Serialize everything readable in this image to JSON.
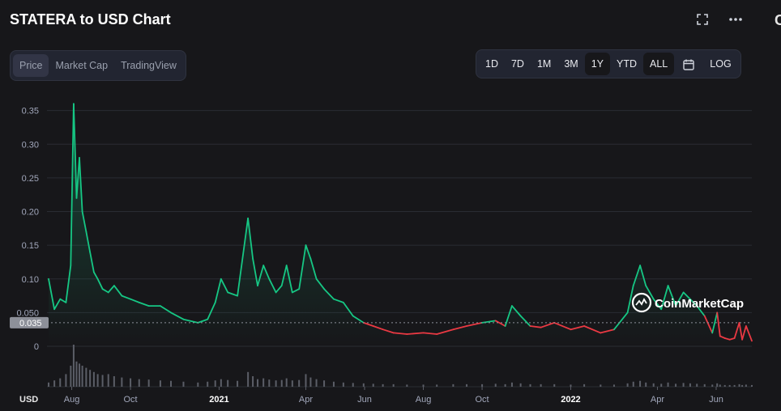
{
  "header": {
    "title": "STATERA to USD Chart",
    "edge_char": "C"
  },
  "view_tabs": [
    "Price",
    "Market Cap",
    "TradingView"
  ],
  "active_view": "Price",
  "range_buttons": [
    "1D",
    "7D",
    "1M",
    "3M",
    "1Y",
    "YTD",
    "ALL"
  ],
  "active_range": "ALL",
  "log_label": "LOG",
  "icons": {
    "fullscreen": "fullscreen-icon",
    "more": "more-icon",
    "calendar": "calendar-icon"
  },
  "colors": {
    "up": "#16c784",
    "down": "#ea3943",
    "background": "#17171a",
    "grid": "#2a2c33",
    "volume": "#5b5e67",
    "price_label_bg": "#8d9099"
  },
  "watermark": "CoinMarketCap",
  "chart_data": {
    "type": "line",
    "currency_label": "USD",
    "current_price_label": "0.035",
    "y_ticks": [
      0,
      0.05,
      0.1,
      0.15,
      0.2,
      0.25,
      0.3,
      0.35
    ],
    "y_tick_labels": [
      "0",
      "0.050",
      "0.10",
      "0.15",
      "0.20",
      "0.25",
      "0.30",
      "0.35"
    ],
    "ylim": [
      0,
      0.37
    ],
    "x_tick_labels": [
      "Aug",
      "Oct",
      "2021",
      "Apr",
      "Jun",
      "Aug",
      "Oct",
      "2022",
      "Apr",
      "Jun"
    ],
    "x_ticks": [
      "2020-08-01",
      "2020-10-01",
      "2021-01-01",
      "2021-04-01",
      "2021-06-01",
      "2021-08-01",
      "2021-10-01",
      "2022-01-01",
      "2022-04-01",
      "2022-06-01"
    ],
    "x_range": [
      "2020-07-08",
      "2022-07-08"
    ],
    "reference_price": 0.035,
    "series": [
      {
        "x": [
          "2020-07-08",
          "2020-07-14",
          "2020-07-20",
          "2020-07-26",
          "2020-07-31",
          "2020-08-03",
          "2020-08-06",
          "2020-08-09",
          "2020-08-12",
          "2020-08-16",
          "2020-08-20",
          "2020-08-24",
          "2020-08-28",
          "2020-09-02",
          "2020-09-08",
          "2020-09-14",
          "2020-09-22",
          "2020-10-01",
          "2020-10-10",
          "2020-10-20",
          "2020-11-01",
          "2020-11-12",
          "2020-11-25",
          "2020-12-10",
          "2020-12-20",
          "2020-12-28",
          "2021-01-03",
          "2021-01-10",
          "2021-01-20",
          "2021-01-31",
          "2021-02-05",
          "2021-02-10",
          "2021-02-16",
          "2021-02-22",
          "2021-03-01",
          "2021-03-07",
          "2021-03-12",
          "2021-03-18",
          "2021-03-25",
          "2021-04-01",
          "2021-04-06",
          "2021-04-12",
          "2021-04-20",
          "2021-04-30",
          "2021-05-10",
          "2021-05-20",
          "2021-05-31",
          "2021-06-10",
          "2021-06-20",
          "2021-07-01",
          "2021-07-15",
          "2021-08-01",
          "2021-08-15",
          "2021-09-01",
          "2021-09-15",
          "2021-10-01",
          "2021-10-15",
          "2021-10-25",
          "2021-11-01",
          "2021-11-10",
          "2021-11-20",
          "2021-12-01",
          "2021-12-15",
          "2022-01-01",
          "2022-01-15",
          "2022-02-01",
          "2022-02-15",
          "2022-03-01",
          "2022-03-07",
          "2022-03-14",
          "2022-03-20",
          "2022-03-28",
          "2022-04-05",
          "2022-04-12",
          "2022-04-20",
          "2022-04-28",
          "2022-05-05",
          "2022-05-12",
          "2022-05-20",
          "2022-05-28",
          "2022-06-02",
          "2022-06-05",
          "2022-06-10",
          "2022-06-15",
          "2022-06-20",
          "2022-06-25",
          "2022-06-28",
          "2022-07-02",
          "2022-07-08"
        ],
        "y": [
          0.1,
          0.055,
          0.07,
          0.065,
          0.12,
          0.36,
          0.22,
          0.28,
          0.2,
          0.17,
          0.14,
          0.11,
          0.1,
          0.085,
          0.08,
          0.09,
          0.075,
          0.07,
          0.065,
          0.06,
          0.06,
          0.05,
          0.04,
          0.035,
          0.04,
          0.065,
          0.1,
          0.08,
          0.075,
          0.19,
          0.13,
          0.09,
          0.12,
          0.1,
          0.08,
          0.09,
          0.12,
          0.08,
          0.085,
          0.15,
          0.13,
          0.1,
          0.085,
          0.07,
          0.065,
          0.045,
          0.035,
          0.03,
          0.025,
          0.02,
          0.018,
          0.02,
          0.018,
          0.025,
          0.03,
          0.035,
          0.038,
          0.03,
          0.06,
          0.045,
          0.03,
          0.028,
          0.035,
          0.025,
          0.03,
          0.02,
          0.025,
          0.05,
          0.09,
          0.12,
          0.09,
          0.07,
          0.055,
          0.09,
          0.06,
          0.08,
          0.07,
          0.06,
          0.045,
          0.02,
          0.05,
          0.015,
          0.012,
          0.01,
          0.012,
          0.035,
          0.01,
          0.03,
          0.008
        ]
      }
    ],
    "volume": [
      0.1,
      0.15,
      0.2,
      0.3,
      0.5,
      1.0,
      0.6,
      0.55,
      0.5,
      0.45,
      0.4,
      0.35,
      0.3,
      0.28,
      0.3,
      0.25,
      0.22,
      0.2,
      0.18,
      0.17,
      0.15,
      0.14,
      0.12,
      0.1,
      0.12,
      0.15,
      0.18,
      0.16,
      0.14,
      0.35,
      0.25,
      0.18,
      0.2,
      0.17,
      0.15,
      0.16,
      0.2,
      0.15,
      0.16,
      0.3,
      0.22,
      0.18,
      0.15,
      0.12,
      0.1,
      0.09,
      0.08,
      0.07,
      0.06,
      0.06,
      0.05,
      0.05,
      0.05,
      0.06,
      0.06,
      0.06,
      0.07,
      0.06,
      0.1,
      0.08,
      0.06,
      0.06,
      0.06,
      0.05,
      0.06,
      0.05,
      0.05,
      0.08,
      0.12,
      0.14,
      0.1,
      0.08,
      0.07,
      0.1,
      0.07,
      0.09,
      0.08,
      0.07,
      0.06,
      0.05,
      0.08,
      0.05,
      0.04,
      0.04,
      0.04,
      0.06,
      0.04,
      0.05,
      0.04
    ]
  }
}
